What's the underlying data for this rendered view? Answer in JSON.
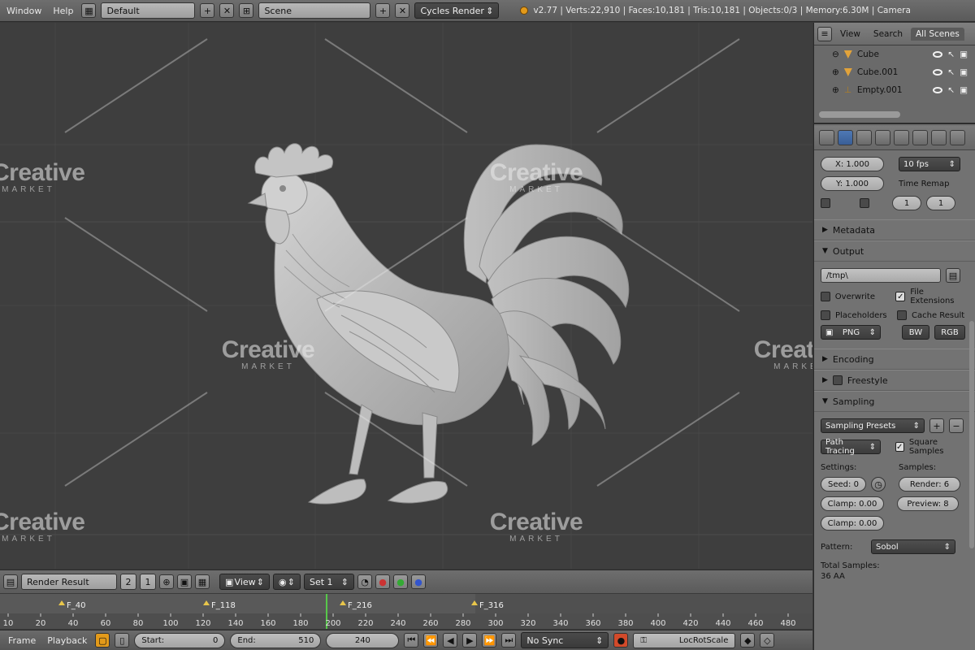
{
  "topbar": {
    "menus": [
      "Window",
      "Help"
    ],
    "layout": "Default",
    "scene": "Scene",
    "engine": "Cycles Render",
    "stats": "v2.77 | Verts:22,910 | Faces:10,181 | Tris:10,181 | Objects:0/3 | Memory:6.30M | Camera"
  },
  "outliner": {
    "tabs": [
      "View",
      "Search",
      "All Scenes"
    ],
    "rows": [
      "Cube",
      "Cube.001",
      "Empty.001"
    ]
  },
  "properties": {
    "dims": {
      "x": "X: 1.000",
      "y": "Y: 1.000"
    },
    "fps": "10 fps",
    "time_remap": "Time Remap",
    "frames": [
      "1",
      "1"
    ],
    "metadata": "Metadata",
    "output": "Output",
    "path": "/tmp\\",
    "overwrite": "Overwrite",
    "file_ext": "File Extensions",
    "placeholders": "Placeholders",
    "cache_result": "Cache Result",
    "format": "PNG",
    "color_bw": "BW",
    "color_rgb": "RGB",
    "encoding": "Encoding",
    "freestyle": "Freestyle",
    "sampling": "Sampling",
    "preset": "Sampling Presets",
    "path_tracing": "Path Tracing",
    "square_samples": "Square Samples",
    "settings_label": "Settings:",
    "samples_label": "Samples:",
    "seed": "Seed: 0",
    "clamp_direct": "Clamp: 0.00",
    "clamp_indirect": "Clamp: 0.00",
    "render_samples": "Render: 6",
    "preview_samples": "Preview: 8",
    "pattern_label": "Pattern:",
    "pattern_value": "Sobol",
    "total_samples": "Total Samples:",
    "total_value": "36 AA"
  },
  "timeline": {
    "editor": "Render Result",
    "frame_a": "2",
    "frame_b": "1",
    "view": "View",
    "keyset": "Set 1",
    "markers": [
      "F_40",
      "F_118",
      "F_216",
      "F_316"
    ],
    "ticks": [
      "10",
      "20",
      "40",
      "60",
      "80",
      "100",
      "120",
      "140",
      "160",
      "180",
      "200",
      "220",
      "240",
      "260",
      "280",
      "300",
      "320",
      "340",
      "360",
      "380",
      "400",
      "420",
      "440",
      "460",
      "480"
    ]
  },
  "bottombar": {
    "frame": "Frame",
    "playback": "Playback",
    "start": "Start:",
    "start_val": "0",
    "end": "End:",
    "end_val": "510",
    "current": "240",
    "sync": "No Sync",
    "keyingset": "LocRotScale"
  },
  "watermark": {
    "brand": "Creative",
    "sub": "MARKET"
  },
  "colors": {
    "viewport": "#3e3e3e",
    "panel": "#727272",
    "header": "#6a6a6a",
    "select": "#4a78b8",
    "accent": "#e39a1a"
  }
}
